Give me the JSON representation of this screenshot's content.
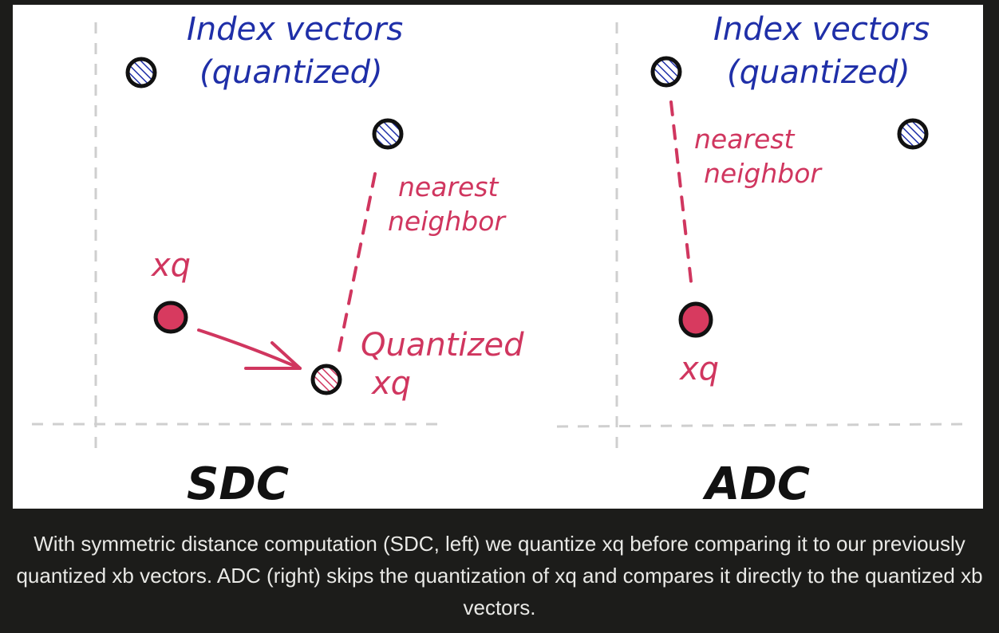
{
  "sdc_panel": {
    "title_line1": "Index vectors",
    "title_line2": "(quantized)",
    "nn_line1": "nearest",
    "nn_line2": "neighbor",
    "query_label": "xq",
    "quantized_line1": "Quantized",
    "quantized_line2": "xq",
    "label": "SDC"
  },
  "adc_panel": {
    "title_line1": "Index vectors",
    "title_line2": "(quantized)",
    "nn_line1": "nearest",
    "nn_line2": "neighbor",
    "query_label": "xq",
    "label": "ADC"
  },
  "caption": "With symmetric distance computation (SDC, left) we quantize xq before comparing it to our previously quantized xb vectors. ADC (right) skips the quantization of xq and compares it directly to the quantized xb vectors.",
  "colors": {
    "background": "#1c1c1a",
    "panel": "#ffffff",
    "title_blue": "#1f2fa8",
    "accent_pink": "#d0365f",
    "query_fill": "#d73a5f",
    "axis_gray": "#cfcfcf",
    "ink": "#111111"
  },
  "icons": {
    "index_vector": "hatched-circle-icon",
    "quantized_query": "pink-hatched-circle-icon",
    "query_vector": "filled-pink-dot-icon",
    "quantize_arrow": "arrow-icon"
  }
}
